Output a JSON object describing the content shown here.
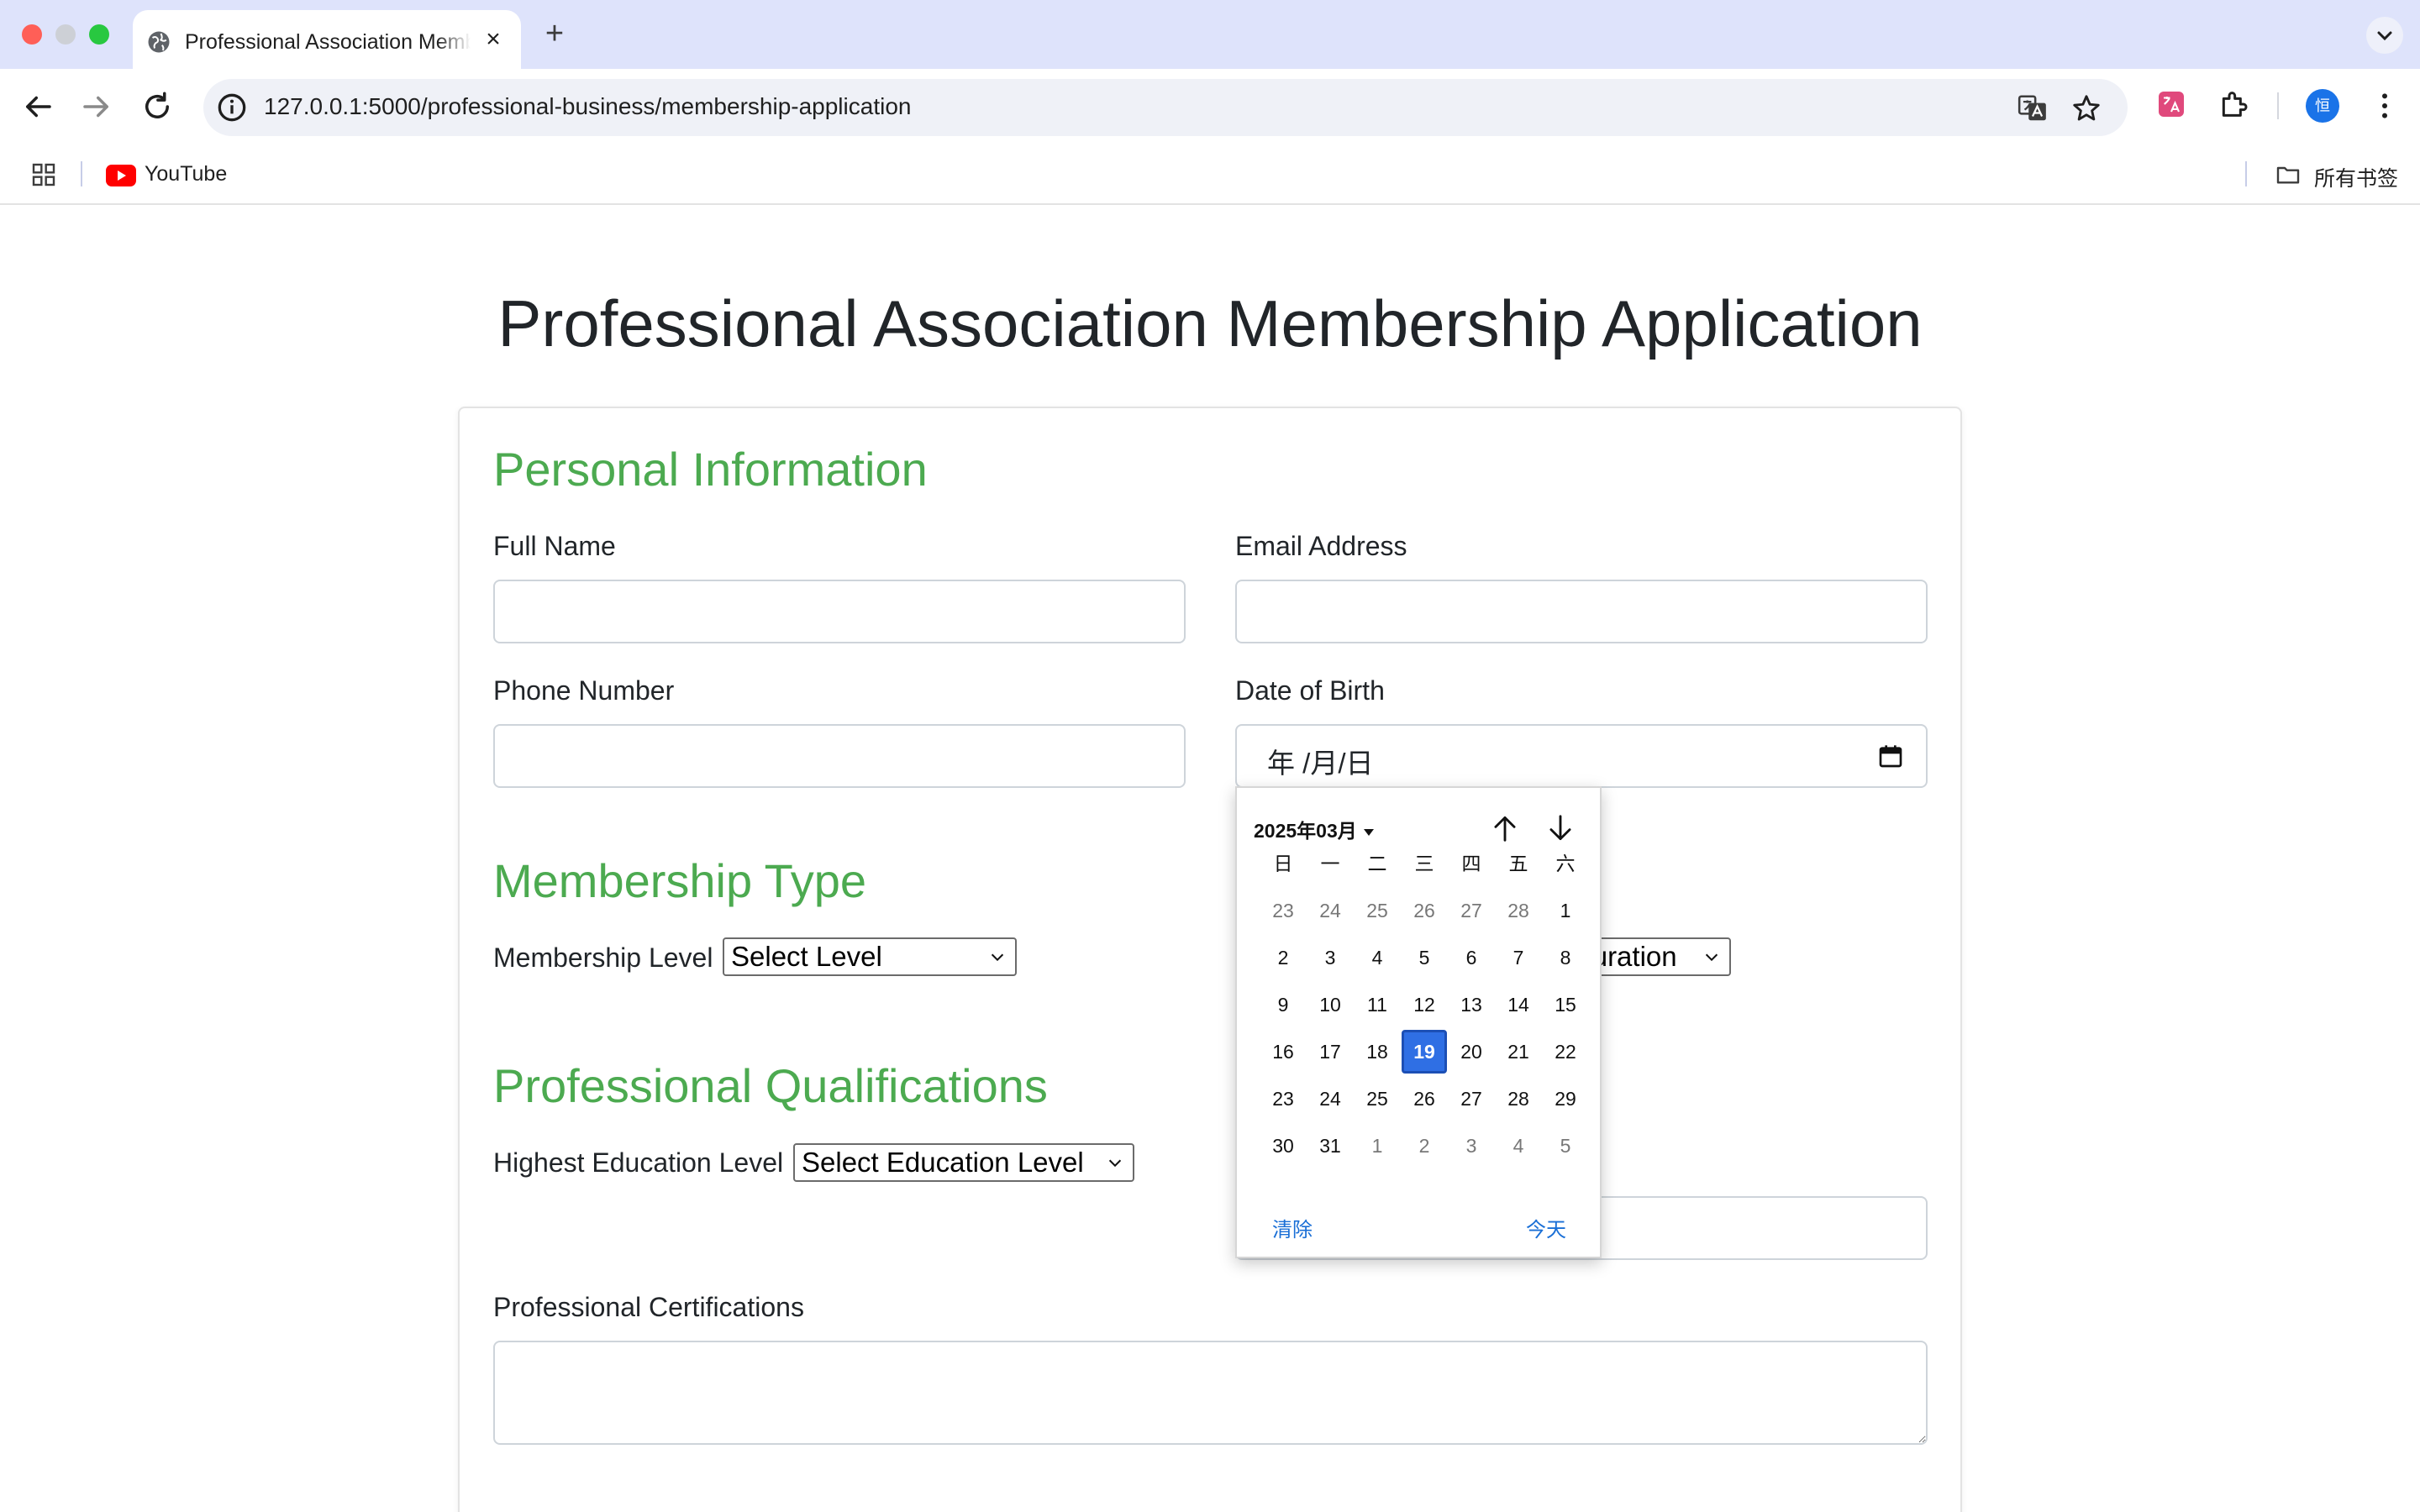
{
  "browser": {
    "tab_title": "Professional Association Membership Application",
    "tab_close": "×",
    "new_tab": "+",
    "url": "127.0.0.1:5000/professional-business/membership-application",
    "bookmarks": [
      {
        "label": "YouTube",
        "icon": "youtube-icon"
      }
    ],
    "all_bookmarks": "所有书签",
    "avatar_initial": "恒"
  },
  "page": {
    "title": "Professional Association Membership Application"
  },
  "personal": {
    "heading": "Personal Information",
    "full_name_label": "Full Name",
    "full_name_value": "",
    "email_label": "Email Address",
    "email_value": "",
    "phone_label": "Phone Number",
    "phone_value": "",
    "dob_label": "Date of Birth",
    "dob_placeholder": "年 /月/日"
  },
  "membership": {
    "heading": "Membership Type",
    "level_label": "Membership Level",
    "level_selected": "Select Level",
    "duration_selected": "Select Duration"
  },
  "qualifications": {
    "heading": "Professional Qualifications",
    "education_label": "Highest Education Level",
    "education_selected": "Select Education Level",
    "certifications_label": "Professional Certifications",
    "certifications_value": ""
  },
  "datepicker": {
    "month_label": "2025年03月",
    "weekdays": [
      "日",
      "一",
      "二",
      "三",
      "四",
      "五",
      "六"
    ],
    "weeks": [
      [
        {
          "d": "23",
          "muted": true
        },
        {
          "d": "24",
          "muted": true
        },
        {
          "d": "25",
          "muted": true
        },
        {
          "d": "26",
          "muted": true
        },
        {
          "d": "27",
          "muted": true
        },
        {
          "d": "28",
          "muted": true
        },
        {
          "d": "1"
        }
      ],
      [
        {
          "d": "2"
        },
        {
          "d": "3"
        },
        {
          "d": "4"
        },
        {
          "d": "5"
        },
        {
          "d": "6"
        },
        {
          "d": "7"
        },
        {
          "d": "8"
        }
      ],
      [
        {
          "d": "9"
        },
        {
          "d": "10"
        },
        {
          "d": "11"
        },
        {
          "d": "12"
        },
        {
          "d": "13"
        },
        {
          "d": "14"
        },
        {
          "d": "15"
        }
      ],
      [
        {
          "d": "16"
        },
        {
          "d": "17"
        },
        {
          "d": "18"
        },
        {
          "d": "19",
          "selected": true
        },
        {
          "d": "20"
        },
        {
          "d": "21"
        },
        {
          "d": "22"
        }
      ],
      [
        {
          "d": "23"
        },
        {
          "d": "24"
        },
        {
          "d": "25"
        },
        {
          "d": "26"
        },
        {
          "d": "27"
        },
        {
          "d": "28"
        },
        {
          "d": "29"
        }
      ],
      [
        {
          "d": "30"
        },
        {
          "d": "31"
        },
        {
          "d": "1",
          "muted": true
        },
        {
          "d": "2",
          "muted": true
        },
        {
          "d": "3",
          "muted": true
        },
        {
          "d": "4",
          "muted": true
        },
        {
          "d": "5",
          "muted": true
        }
      ]
    ],
    "clear_label": "清除",
    "today_label": "今天",
    "selected_color": "#2f6fe4"
  },
  "colors": {
    "section_heading": "#4caa50",
    "tabstrip": "#dee3fb",
    "link": "#1a6fd6"
  }
}
